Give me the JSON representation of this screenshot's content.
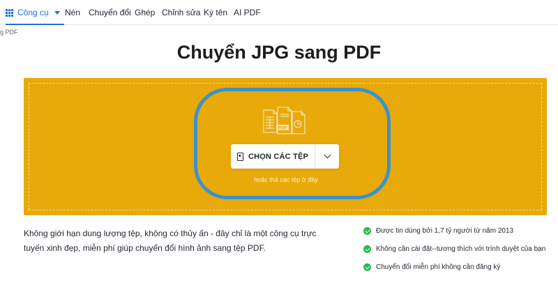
{
  "topbar": {
    "tools_label": "Công cụ",
    "nav": [
      "Nén",
      "Chuyển đổi",
      "Ghép",
      "Chỉnh sửa",
      "Ký tên",
      "AI PDF"
    ]
  },
  "breadcrumb": "g PDF",
  "page_title": "Chuyển JPG sang PDF",
  "dropzone": {
    "icon_label": "PDF",
    "choose_label": "CHỌN CÁC TỆP",
    "hint": "hoặc thả các tệp ở đây"
  },
  "description": "Không giới hạn dung lượng tệp, không có thủy ấn - đây chỉ là một công cụ trực tuyến xinh đẹp, miễn phí giúp chuyển đổi hình ảnh sang tệp PDF.",
  "features": [
    "Được tin dùng bởi 1,7 tỷ người từ năm 2013",
    "Không cần cài đặt--tương thích với trình duyệt của bạn",
    "Chuyển đổi miễn phí không cần đăng ký"
  ],
  "colors": {
    "accent": "#1f6fe0",
    "dropzone": "#e8a90b",
    "highlight_ring": "#3a93c9",
    "check": "#2db84b"
  }
}
